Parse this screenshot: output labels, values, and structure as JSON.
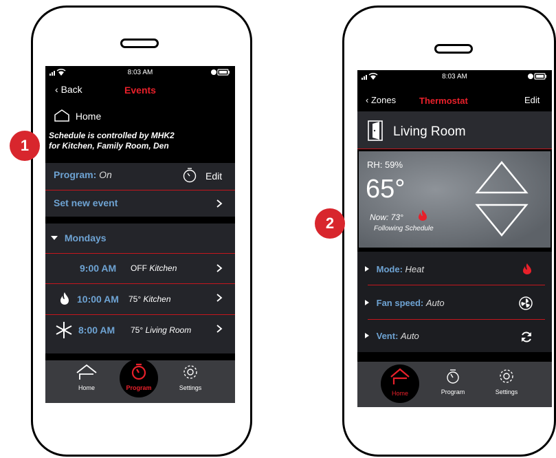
{
  "callouts": [
    "1",
    "2"
  ],
  "colors": {
    "accent_red": "#e8202a",
    "label_blue": "#6ea3d3",
    "panel": "#24252a",
    "tabbar": "#3b3c40"
  },
  "phone1": {
    "status_time": "8:03 AM",
    "back_label": "Back",
    "title": "Events",
    "home_label": "Home",
    "message_line1": "Schedule is controlled  by MHK2",
    "message_line2": "for  Kitchen, Family Room, Den",
    "program_label": "Program:",
    "program_value": "On",
    "edit_label": "Edit",
    "set_new_event": "Set new event",
    "day_header": "Mondays",
    "events": [
      {
        "time": "9:00 AM",
        "setting": "OFF",
        "zone": "Kitchen",
        "icon": "none"
      },
      {
        "time": "10:00 AM",
        "setting": "75°",
        "zone": "Kitchen",
        "icon": "flame-icon"
      },
      {
        "time": "8:00 AM",
        "setting": "75°",
        "zone": "Living Room",
        "icon": "snowflake-icon"
      }
    ],
    "tabs": [
      {
        "label": "Home",
        "icon": "home-icon",
        "active": false
      },
      {
        "label": "Program",
        "icon": "timer-icon",
        "active": true
      },
      {
        "label": "Settings",
        "icon": "gear-icon",
        "active": false
      }
    ]
  },
  "phone2": {
    "status_time": "8:03 AM",
    "back_label": "Zones",
    "title": "Thermostat",
    "edit_label": "Edit",
    "room_name": "Living Room",
    "humidity": "RH: 59%",
    "setpoint": "65°",
    "now_temp": "Now: 73°",
    "following": "Following  Schedule",
    "mode_label": "Mode:",
    "mode_value": "Heat",
    "fan_label": "Fan speed:",
    "fan_value": "Auto",
    "vent_label": "Vent:",
    "vent_value": "Auto",
    "tabs": [
      {
        "label": "Home",
        "icon": "home-icon",
        "active": true
      },
      {
        "label": "Program",
        "icon": "timer-icon",
        "active": false
      },
      {
        "label": "Settings",
        "icon": "gear-icon",
        "active": false
      }
    ]
  }
}
